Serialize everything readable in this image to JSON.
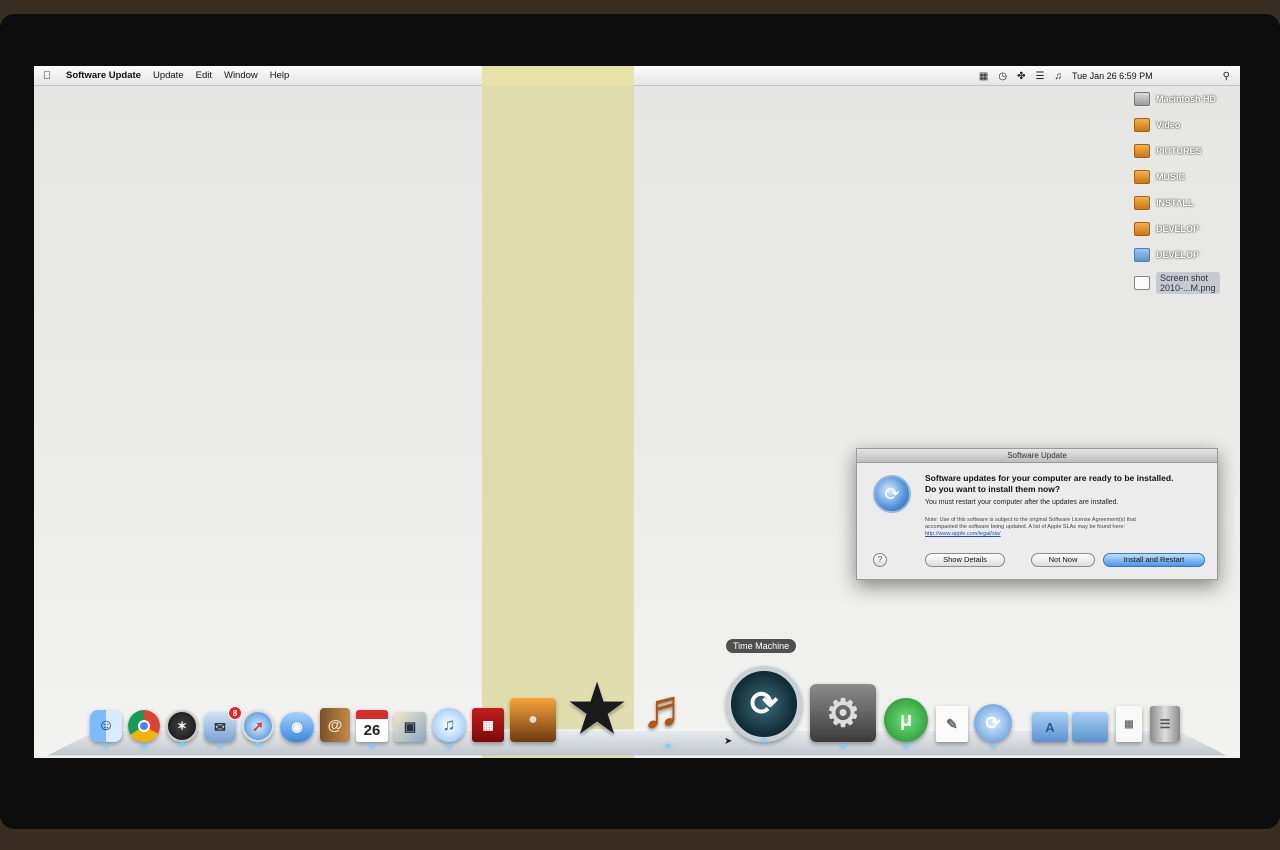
{
  "menubar": {
    "app_name": "Software Update",
    "items": [
      "Update",
      "Edit",
      "Window",
      "Help"
    ],
    "datetime": "Tue Jan 26  6:59 PM",
    "status_icons": [
      "script-icon",
      "time-machine-icon",
      "bluetooth-icon",
      "wifi-icon",
      "volume-icon"
    ]
  },
  "desktop": {
    "items": [
      {
        "label": "Macintosh HD",
        "type": "hd"
      },
      {
        "label": "Video",
        "type": "drive"
      },
      {
        "label": "PICTURES",
        "type": "drive"
      },
      {
        "label": "MUSIC",
        "type": "drive"
      },
      {
        "label": "INSTALL",
        "type": "drive"
      },
      {
        "label": "DEVELOP",
        "type": "drive"
      },
      {
        "label": "DEVELOP",
        "type": "folder"
      },
      {
        "label": "Screen shot\n2010-...M.png",
        "type": "png"
      }
    ]
  },
  "dialog": {
    "title": "Software Update",
    "heading": "Software updates for your computer are ready to be installed.\nDo you want to install them now?",
    "message": "You must restart your computer after the updates are installed.",
    "note": "Note: Use of this software is subject to the original Software License Agreement(s) that accompanied the software being updated. A list of Apple SLAs may be found here: ",
    "note_link": "http://www.apple.com/legal/sla/",
    "buttons": {
      "details": "Show Details",
      "not_now": "Not Now",
      "install": "Install and Restart",
      "help": "?"
    }
  },
  "dock": {
    "tooltip": "Time Machine",
    "mail_badge": "8",
    "calendar_date": "26",
    "items": [
      "finder",
      "chrome",
      "network-radar",
      "mail",
      "safari",
      "ichat",
      "address-book",
      "ical",
      "iphoto-preview",
      "itunes",
      "photo-booth",
      "iphoto",
      "imovie",
      "garageband",
      "time-machine",
      "system-preferences",
      "utorrent",
      "textedit",
      "software-update",
      "applications-folder",
      "documents-folder",
      "downloads-stack",
      "trash"
    ]
  }
}
